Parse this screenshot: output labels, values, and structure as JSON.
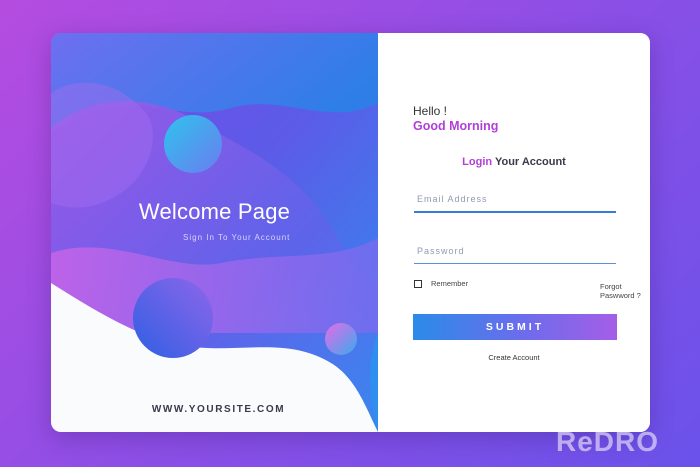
{
  "colors": {
    "accent": "#b13fd7",
    "button_start": "#2b8be8",
    "button_end": "#a45ee6",
    "background_start": "#b54ce0",
    "background_end": "#6a52ea"
  },
  "hero": {
    "title": "Welcome Page",
    "subtitle": "Sign In To Your Account",
    "site": "WWW.YOURSITE.COM"
  },
  "form": {
    "hello": "Hello !",
    "greeting": "Good Morning",
    "heading_accent": "Login",
    "heading_rest": " Your Account",
    "email_placeholder": "Email Address",
    "password_placeholder": "Password",
    "remember_label": "Remember",
    "remember_checked": false,
    "forgot_label": "Forgot Paswword ?",
    "submit_label": "SUBMIT",
    "create_label": "Create Account"
  },
  "watermark": "ReDRO"
}
